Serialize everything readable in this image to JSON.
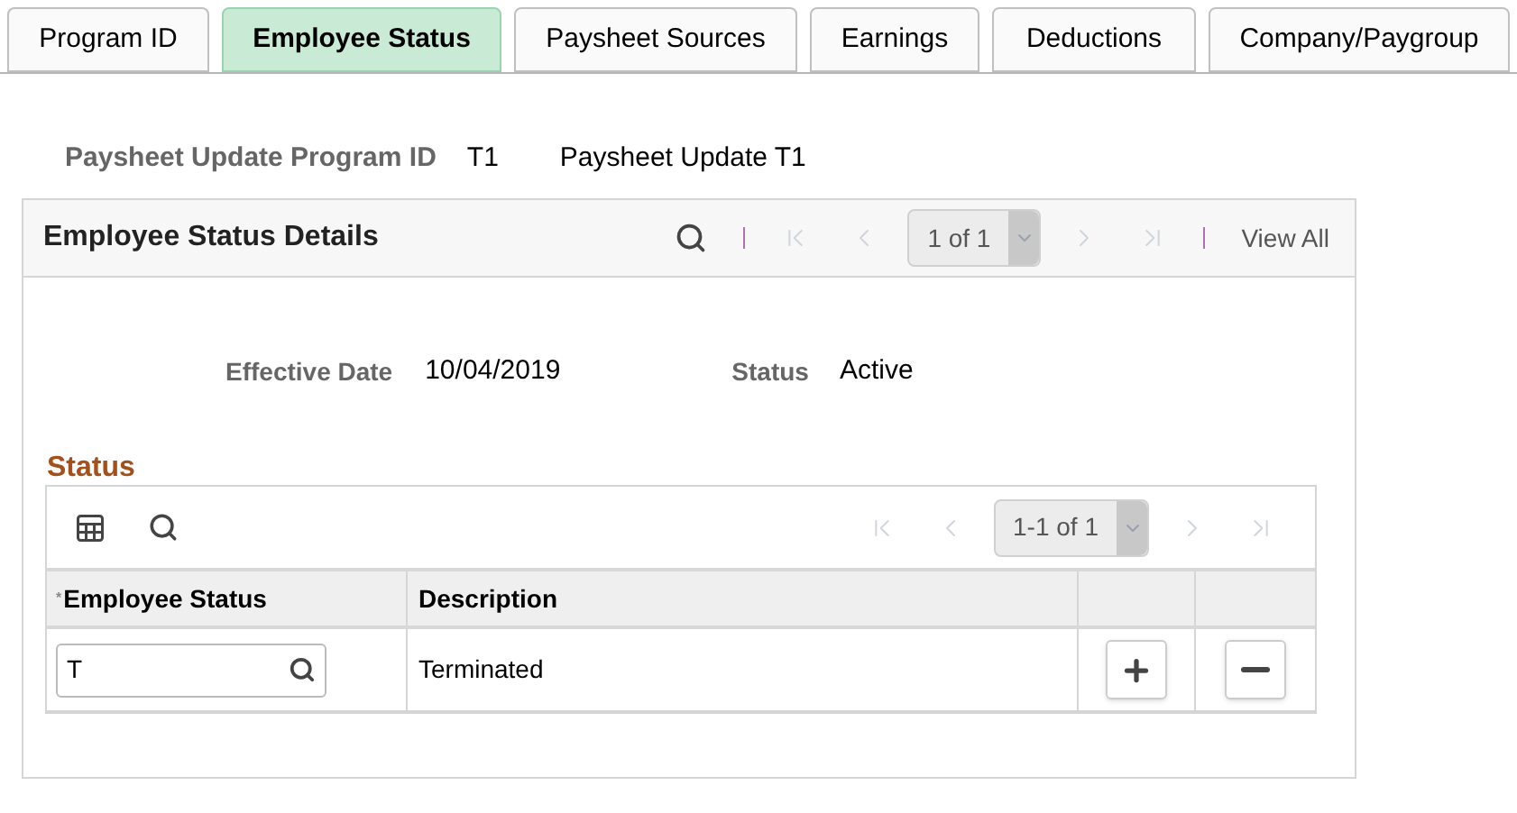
{
  "tabs": [
    {
      "label": "Program ID",
      "selected": false
    },
    {
      "label": "Employee Status",
      "selected": true
    },
    {
      "label": "Paysheet Sources",
      "selected": false
    },
    {
      "label": "Earnings",
      "selected": false
    },
    {
      "label": "Deductions",
      "selected": false
    },
    {
      "label": "Company/Paygroup",
      "selected": false
    }
  ],
  "program": {
    "label": "Paysheet Update Program ID",
    "id": "T1",
    "description": "Paysheet Update T1"
  },
  "details": {
    "title": "Employee Status Details",
    "pager": "1 of 1",
    "view_all": "View All",
    "fields": [
      {
        "label": "Effective Date",
        "value": "10/04/2019"
      },
      {
        "label": "Status",
        "value": "Active"
      }
    ]
  },
  "status_grid": {
    "title": "Status",
    "pager": "1-1 of 1",
    "columns": [
      {
        "label": "Employee Status",
        "required_mark": "*"
      },
      {
        "label": "Description"
      }
    ],
    "rows": [
      {
        "employee_status": "T",
        "description": "Terminated"
      }
    ]
  }
}
